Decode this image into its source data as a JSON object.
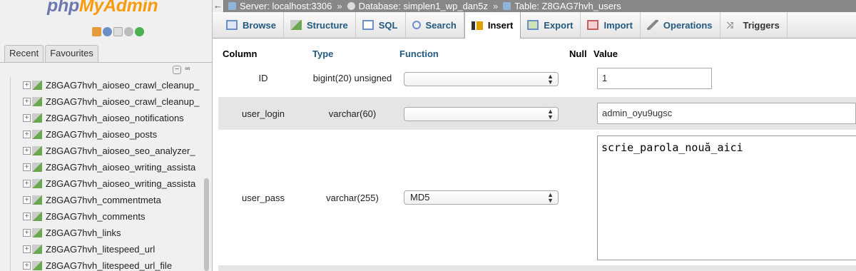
{
  "logo": {
    "php": "php",
    "pma": "MyAdmin"
  },
  "sidebar": {
    "recent_tab": "Recent",
    "favourites_tab": "Favourites",
    "tables": [
      "Z8GAG7hvh_aioseo_crawl_cleanup_",
      "Z8GAG7hvh_aioseo_crawl_cleanup_",
      "Z8GAG7hvh_aioseo_notifications",
      "Z8GAG7hvh_aioseo_posts",
      "Z8GAG7hvh_aioseo_seo_analyzer_",
      "Z8GAG7hvh_aioseo_writing_assista",
      "Z8GAG7hvh_aioseo_writing_assista",
      "Z8GAG7hvh_commentmeta",
      "Z8GAG7hvh_comments",
      "Z8GAG7hvh_links",
      "Z8GAG7hvh_litespeed_url",
      "Z8GAG7hvh_litespeed_url_file"
    ]
  },
  "breadcrumb": {
    "server": "Server: localhost:3306",
    "database": "Database: simplen1_wp_dan5z",
    "table": "Table: Z8GAG7hvh_users",
    "separator": "»"
  },
  "tabs": [
    {
      "label": "Browse"
    },
    {
      "label": "Structure"
    },
    {
      "label": "SQL"
    },
    {
      "label": "Search"
    },
    {
      "label": "Insert"
    },
    {
      "label": "Export"
    },
    {
      "label": "Import"
    },
    {
      "label": "Operations"
    },
    {
      "label": "Triggers"
    }
  ],
  "active_tab": "Insert",
  "table_headers": {
    "column": "Column",
    "type": "Type",
    "function": "Function",
    "null": "Null",
    "value": "Value"
  },
  "rows": [
    {
      "column": "ID",
      "type": "bigint(20) unsigned",
      "function": "",
      "value": "1"
    },
    {
      "column": "user_login",
      "type": "varchar(60)",
      "function": "",
      "value": "admin_oyu9ugsc"
    },
    {
      "column": "user_pass",
      "type": "varchar(255)",
      "function": "MD5",
      "value": "scrie_parola_nouă_aici"
    }
  ],
  "colors": {
    "accent": "#235a81",
    "logo_php": "#6c78af",
    "logo_admin": "#f89c0e",
    "row_shade": "#e5e5e5"
  }
}
